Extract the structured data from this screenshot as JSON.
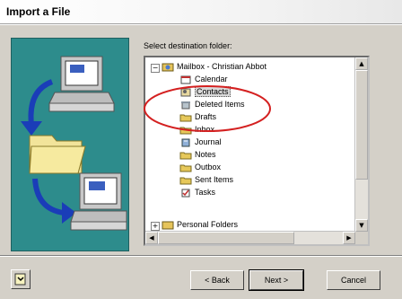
{
  "window": {
    "title": "Import a File"
  },
  "wizard": {
    "instruction": "Select destination folder:"
  },
  "tree": {
    "root": "Mailbox - Christian Abbot",
    "folders": [
      {
        "label": "Calendar",
        "icon": "calendar-icon"
      },
      {
        "label": "Contacts",
        "icon": "contacts-icon",
        "selected": true
      },
      {
        "label": "Deleted Items",
        "icon": "deleted-items-icon"
      },
      {
        "label": "Drafts",
        "icon": "drafts-icon"
      },
      {
        "label": "Inbox",
        "icon": "inbox-icon"
      },
      {
        "label": "Journal",
        "icon": "journal-icon"
      },
      {
        "label": "Notes",
        "icon": "notes-icon"
      },
      {
        "label": "Outbox",
        "icon": "outbox-icon"
      },
      {
        "label": "Sent Items",
        "icon": "sent-items-icon"
      },
      {
        "label": "Tasks",
        "icon": "tasks-icon"
      }
    ],
    "next_root": "Personal Folders"
  },
  "buttons": {
    "back": "< Back",
    "next": "Next >",
    "cancel": "Cancel"
  },
  "colors": {
    "panel": "#2d8c8c",
    "highlight_circle": "#d42020",
    "dialog": "#d4d0c8"
  }
}
